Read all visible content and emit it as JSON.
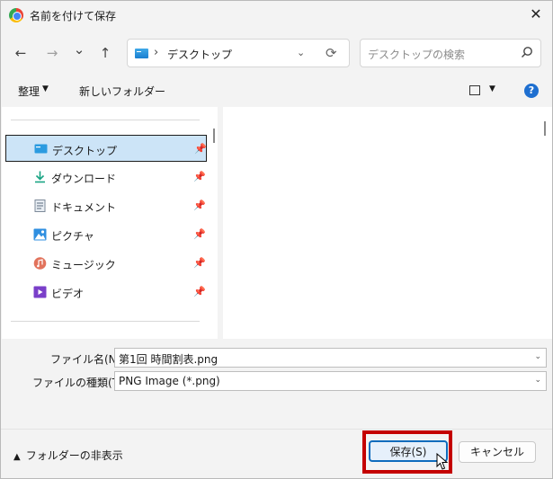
{
  "window": {
    "title": "名前を付けて保存",
    "close_glyph": "✕"
  },
  "nav": {
    "back_glyph": "←",
    "forward_glyph": "→",
    "recent_glyph": "⌄",
    "up_glyph": "↑",
    "address": {
      "separator": "›",
      "location": "デスクトップ",
      "dropdown_glyph": "⌄",
      "refresh_glyph": "⟳"
    },
    "search": {
      "placeholder": "デスクトップの検索"
    }
  },
  "toolbar": {
    "organize": "整理",
    "organize_caret": "▼",
    "new_folder": "新しいフォルダー",
    "view_caret": "▼",
    "help": "?"
  },
  "sidebar": {
    "pin_glyph": "📌",
    "items": [
      {
        "label": "デスクトップ",
        "icon": "desktop-icon",
        "selected": true
      },
      {
        "label": "ダウンロード",
        "icon": "download-icon",
        "selected": false
      },
      {
        "label": "ドキュメント",
        "icon": "document-icon",
        "selected": false
      },
      {
        "label": "ピクチャ",
        "icon": "pictures-icon",
        "selected": false
      },
      {
        "label": "ミュージック",
        "icon": "music-icon",
        "selected": false
      },
      {
        "label": "ビデオ",
        "icon": "video-icon",
        "selected": false
      }
    ]
  },
  "fields": {
    "filename_label": "ファイル名(N):",
    "filename_value": "第1回 時間割表.png",
    "filetype_label": "ファイルの種類(T):",
    "filetype_value": "PNG Image (*.png)",
    "caret": "⌄"
  },
  "footer": {
    "hide_folders_caret": "▲",
    "hide_folders": "フォルダーの非表示",
    "save": "保存(S)",
    "cancel": "キャンセル"
  },
  "colors": {
    "accent": "#0f6cbd",
    "highlight_box": "#c40000",
    "selected_bg": "#cce4f7"
  }
}
